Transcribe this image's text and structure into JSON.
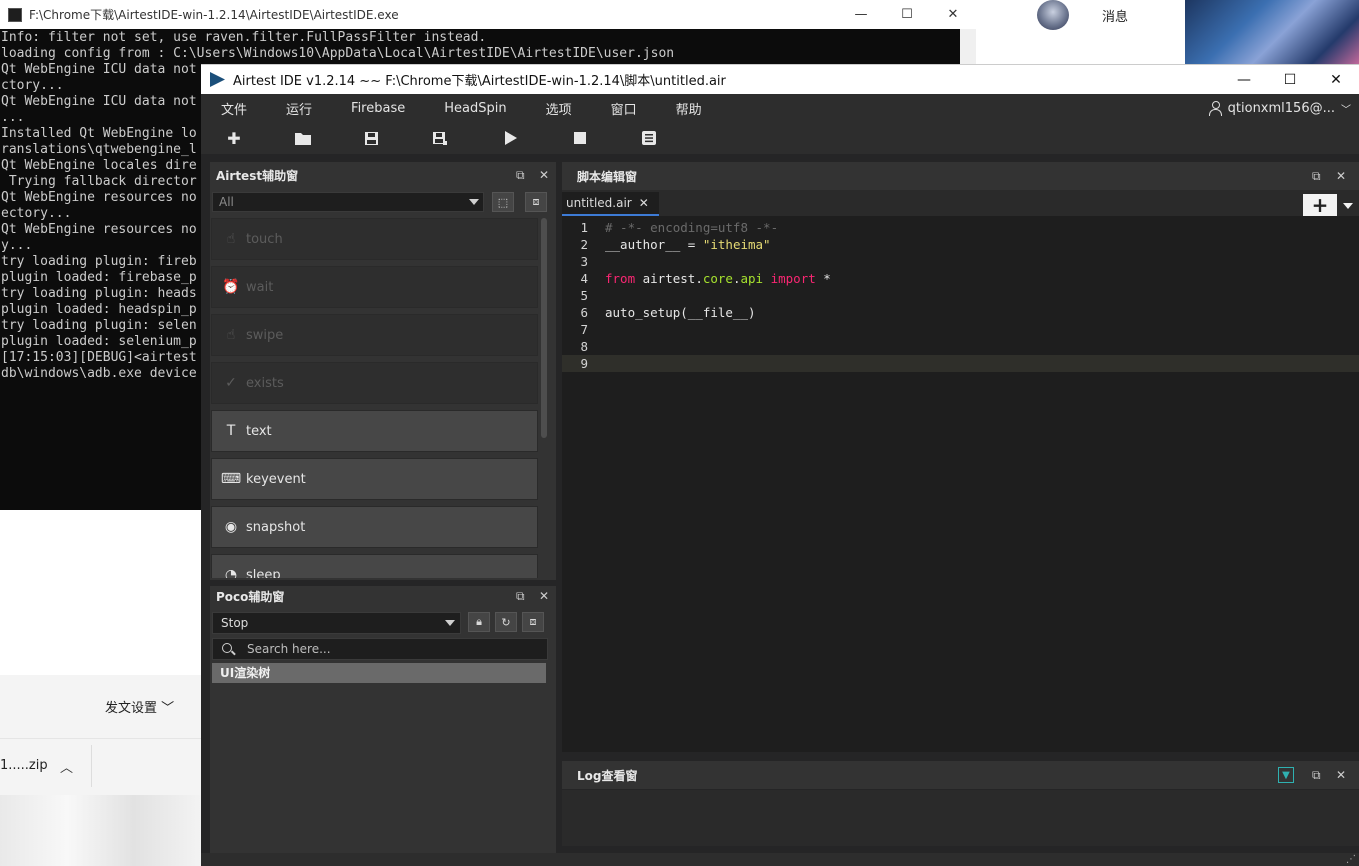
{
  "console": {
    "title": "F:\\Chrome下载\\AirtestIDE-win-1.2.14\\AirtestIDE\\AirtestIDE.exe",
    "lines": [
      "Info: filter not set, use raven.filter.FullPassFilter instead.",
      "loading config from : C:\\Users\\Windows10\\AppData\\Local\\AirtestIDE\\AirtestIDE\\user.json",
      "Qt WebEngine ICU data not",
      "ctory...",
      "Qt WebEngine ICU data not",
      "...",
      "Installed Qt WebEngine lo",
      "ranslations\\qtwebengine_l",
      "Qt WebEngine locales dire",
      " Trying fallback director",
      "Qt WebEngine resources no",
      "ectory...",
      "Qt WebEngine resources no",
      "y...",
      "try loading plugin: fireb",
      "plugin loaded: firebase_p",
      "try loading plugin: heads",
      "plugin loaded: headspin_p",
      "try loading plugin: selen",
      "plugin loaded: selenium_p",
      "[17:15:03][DEBUG]<airtest",
      "db\\windows\\adb.exe device"
    ]
  },
  "window_controls": {
    "minimize": "—",
    "maximize": "☐",
    "close": "✕"
  },
  "background": {
    "chat_label": "消息",
    "post_settings": "发文设置",
    "download_file": "1.....zip"
  },
  "ide": {
    "title": "Airtest IDE v1.2.14 ~~ F:\\Chrome下载\\AirtestIDE-win-1.2.14\\脚本\\untitled.air",
    "menu": [
      "文件",
      "运行",
      "Firebase",
      "HeadSpin",
      "选项",
      "窗口",
      "帮助"
    ],
    "user": "qtionxml156@...",
    "toolbar_icons": [
      "new-file-icon",
      "open-folder-icon",
      "save-icon",
      "save-as-icon",
      "run-icon",
      "stop-icon",
      "log-report-icon"
    ]
  },
  "airtest_panel": {
    "title": "Airtest辅助窗",
    "filter_value": "All",
    "apis": [
      {
        "label": "touch",
        "enabled": false,
        "icon": "☝"
      },
      {
        "label": "wait",
        "enabled": false,
        "icon": "⏰"
      },
      {
        "label": "swipe",
        "enabled": false,
        "icon": "☝"
      },
      {
        "label": "exists",
        "enabled": false,
        "icon": "✓"
      },
      {
        "label": "text",
        "enabled": true,
        "icon": "T"
      },
      {
        "label": "keyevent",
        "enabled": true,
        "icon": "⌨"
      },
      {
        "label": "snapshot",
        "enabled": true,
        "icon": "◉"
      },
      {
        "label": "sleep",
        "enabled": true,
        "icon": "◔"
      }
    ]
  },
  "poco_panel": {
    "title": "Poco辅助窗",
    "mode": "Stop",
    "search_placeholder": "Search here...",
    "tree_root": "UI渲染树"
  },
  "editor": {
    "title": "脚本编辑窗",
    "tab": "untitled.air",
    "current_line": 9,
    "lines": [
      {
        "n": "1",
        "parts": [
          {
            "t": "# -*- encoding=utf8 -*-",
            "c": "comment"
          }
        ]
      },
      {
        "n": "2",
        "parts": [
          {
            "t": "__author__ = ",
            "c": "plain"
          },
          {
            "t": "\"itheima\"",
            "c": "string"
          }
        ]
      },
      {
        "n": "3",
        "parts": []
      },
      {
        "n": "4",
        "parts": [
          {
            "t": "from",
            "c": "kw"
          },
          {
            "t": " airtest.",
            "c": "plain"
          },
          {
            "t": "core",
            "c": "mod"
          },
          {
            "t": ".",
            "c": "plain"
          },
          {
            "t": "api",
            "c": "mod"
          },
          {
            "t": " ",
            "c": "plain"
          },
          {
            "t": "import",
            "c": "kw"
          },
          {
            "t": " *",
            "c": "plain"
          }
        ]
      },
      {
        "n": "5",
        "parts": []
      },
      {
        "n": "6",
        "parts": [
          {
            "t": "auto_setup(__file__)",
            "c": "plain"
          }
        ]
      },
      {
        "n": "7",
        "parts": []
      },
      {
        "n": "8",
        "parts": []
      },
      {
        "n": "9",
        "parts": []
      }
    ]
  },
  "log_panel": {
    "title": "Log查看窗"
  },
  "colors": {
    "ide_bg": "#252526",
    "panel_bg": "#333333",
    "editor_bg": "#1e1e1e",
    "accent_tab": "#3d7bd6",
    "keyword": "#f92672",
    "string": "#e6db74",
    "module": "#a6e22e",
    "comment": "#6a6a6a"
  }
}
